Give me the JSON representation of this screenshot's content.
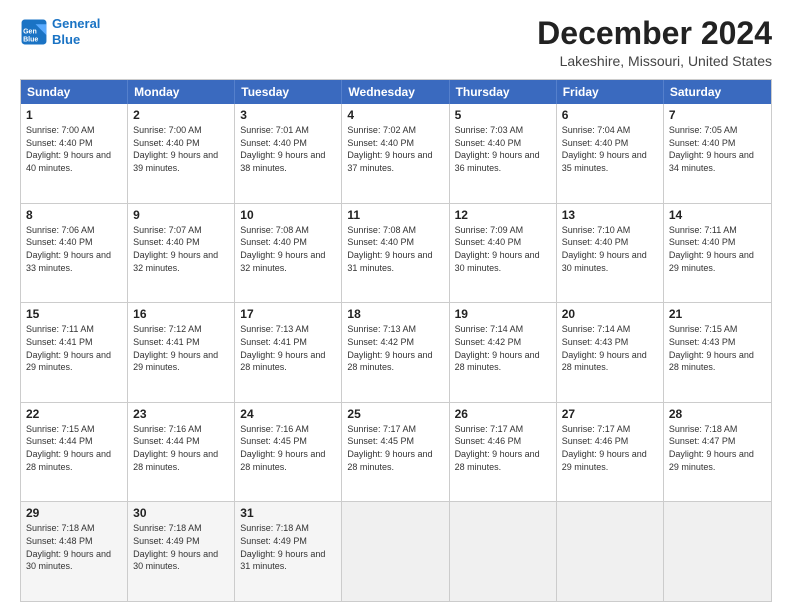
{
  "logo": {
    "line1": "General",
    "line2": "Blue"
  },
  "title": "December 2024",
  "location": "Lakeshire, Missouri, United States",
  "days_of_week": [
    "Sunday",
    "Monday",
    "Tuesday",
    "Wednesday",
    "Thursday",
    "Friday",
    "Saturday"
  ],
  "weeks": [
    [
      {
        "day": "1",
        "sunrise": "7:00 AM",
        "sunset": "4:40 PM",
        "daylight": "9 hours and 40 minutes."
      },
      {
        "day": "2",
        "sunrise": "7:00 AM",
        "sunset": "4:40 PM",
        "daylight": "9 hours and 39 minutes."
      },
      {
        "day": "3",
        "sunrise": "7:01 AM",
        "sunset": "4:40 PM",
        "daylight": "9 hours and 38 minutes."
      },
      {
        "day": "4",
        "sunrise": "7:02 AM",
        "sunset": "4:40 PM",
        "daylight": "9 hours and 37 minutes."
      },
      {
        "day": "5",
        "sunrise": "7:03 AM",
        "sunset": "4:40 PM",
        "daylight": "9 hours and 36 minutes."
      },
      {
        "day": "6",
        "sunrise": "7:04 AM",
        "sunset": "4:40 PM",
        "daylight": "9 hours and 35 minutes."
      },
      {
        "day": "7",
        "sunrise": "7:05 AM",
        "sunset": "4:40 PM",
        "daylight": "9 hours and 34 minutes."
      }
    ],
    [
      {
        "day": "8",
        "sunrise": "7:06 AM",
        "sunset": "4:40 PM",
        "daylight": "9 hours and 33 minutes."
      },
      {
        "day": "9",
        "sunrise": "7:07 AM",
        "sunset": "4:40 PM",
        "daylight": "9 hours and 32 minutes."
      },
      {
        "day": "10",
        "sunrise": "7:08 AM",
        "sunset": "4:40 PM",
        "daylight": "9 hours and 32 minutes."
      },
      {
        "day": "11",
        "sunrise": "7:08 AM",
        "sunset": "4:40 PM",
        "daylight": "9 hours and 31 minutes."
      },
      {
        "day": "12",
        "sunrise": "7:09 AM",
        "sunset": "4:40 PM",
        "daylight": "9 hours and 30 minutes."
      },
      {
        "day": "13",
        "sunrise": "7:10 AM",
        "sunset": "4:40 PM",
        "daylight": "9 hours and 30 minutes."
      },
      {
        "day": "14",
        "sunrise": "7:11 AM",
        "sunset": "4:40 PM",
        "daylight": "9 hours and 29 minutes."
      }
    ],
    [
      {
        "day": "15",
        "sunrise": "7:11 AM",
        "sunset": "4:41 PM",
        "daylight": "9 hours and 29 minutes."
      },
      {
        "day": "16",
        "sunrise": "7:12 AM",
        "sunset": "4:41 PM",
        "daylight": "9 hours and 29 minutes."
      },
      {
        "day": "17",
        "sunrise": "7:13 AM",
        "sunset": "4:41 PM",
        "daylight": "9 hours and 28 minutes."
      },
      {
        "day": "18",
        "sunrise": "7:13 AM",
        "sunset": "4:42 PM",
        "daylight": "9 hours and 28 minutes."
      },
      {
        "day": "19",
        "sunrise": "7:14 AM",
        "sunset": "4:42 PM",
        "daylight": "9 hours and 28 minutes."
      },
      {
        "day": "20",
        "sunrise": "7:14 AM",
        "sunset": "4:43 PM",
        "daylight": "9 hours and 28 minutes."
      },
      {
        "day": "21",
        "sunrise": "7:15 AM",
        "sunset": "4:43 PM",
        "daylight": "9 hours and 28 minutes."
      }
    ],
    [
      {
        "day": "22",
        "sunrise": "7:15 AM",
        "sunset": "4:44 PM",
        "daylight": "9 hours and 28 minutes."
      },
      {
        "day": "23",
        "sunrise": "7:16 AM",
        "sunset": "4:44 PM",
        "daylight": "9 hours and 28 minutes."
      },
      {
        "day": "24",
        "sunrise": "7:16 AM",
        "sunset": "4:45 PM",
        "daylight": "9 hours and 28 minutes."
      },
      {
        "day": "25",
        "sunrise": "7:17 AM",
        "sunset": "4:45 PM",
        "daylight": "9 hours and 28 minutes."
      },
      {
        "day": "26",
        "sunrise": "7:17 AM",
        "sunset": "4:46 PM",
        "daylight": "9 hours and 28 minutes."
      },
      {
        "day": "27",
        "sunrise": "7:17 AM",
        "sunset": "4:46 PM",
        "daylight": "9 hours and 29 minutes."
      },
      {
        "day": "28",
        "sunrise": "7:18 AM",
        "sunset": "4:47 PM",
        "daylight": "9 hours and 29 minutes."
      }
    ],
    [
      {
        "day": "29",
        "sunrise": "7:18 AM",
        "sunset": "4:48 PM",
        "daylight": "9 hours and 30 minutes."
      },
      {
        "day": "30",
        "sunrise": "7:18 AM",
        "sunset": "4:49 PM",
        "daylight": "9 hours and 30 minutes."
      },
      {
        "day": "31",
        "sunrise": "7:18 AM",
        "sunset": "4:49 PM",
        "daylight": "9 hours and 31 minutes."
      },
      null,
      null,
      null,
      null
    ]
  ],
  "labels": {
    "sunrise": "Sunrise:",
    "sunset": "Sunset:",
    "daylight": "Daylight:"
  }
}
